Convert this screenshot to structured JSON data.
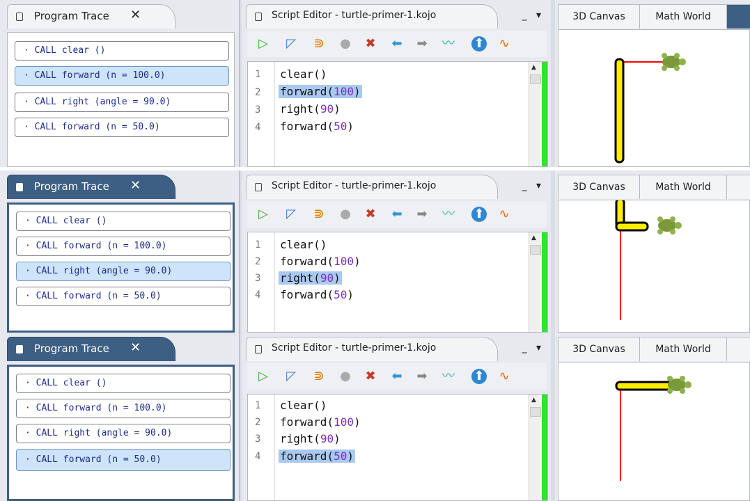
{
  "trace": {
    "title": "Program Trace",
    "close": "✕",
    "calls": [
      "· CALL clear ()",
      "· CALL forward (n = 100.0)",
      "· CALL right (angle = 90.0)",
      "· CALL forward (n = 50.0)"
    ]
  },
  "editor": {
    "title": "Script Editor - turtle-primer-1.kojo",
    "minimize": "_",
    "menu": "▾",
    "lines": [
      {
        "num": "1",
        "fn": "clear",
        "arg": ""
      },
      {
        "num": "2",
        "fn": "forward",
        "arg": "100"
      },
      {
        "num": "3",
        "fn": "right",
        "arg": "90"
      },
      {
        "num": "4",
        "fn": "forward",
        "arg": "50"
      }
    ],
    "toolbar_icons": [
      "run-icon",
      "run-worksheet-icon",
      "trace-icon",
      "stop-icon",
      "clear-icon",
      "back-icon",
      "forward-icon",
      "format-icon",
      "upload-icon",
      "turtle-icon"
    ]
  },
  "canvas": {
    "tabs": [
      "3D Canvas",
      "Math World"
    ]
  },
  "steps": [
    {
      "trace_highlight": 1,
      "editor_highlight": 1
    },
    {
      "trace_highlight": 2,
      "editor_highlight": 2
    },
    {
      "trace_highlight": 3,
      "editor_highlight": 3
    }
  ],
  "colors": {
    "active_tab": "#3d5f84",
    "highlight_row": "#cde4fb",
    "code_highlight": "#a9c9f1",
    "number": "#7a2fc1",
    "pen_line": "#ff0000",
    "yellow_path": "#ffee00",
    "green_bar": "#2ee62e"
  }
}
